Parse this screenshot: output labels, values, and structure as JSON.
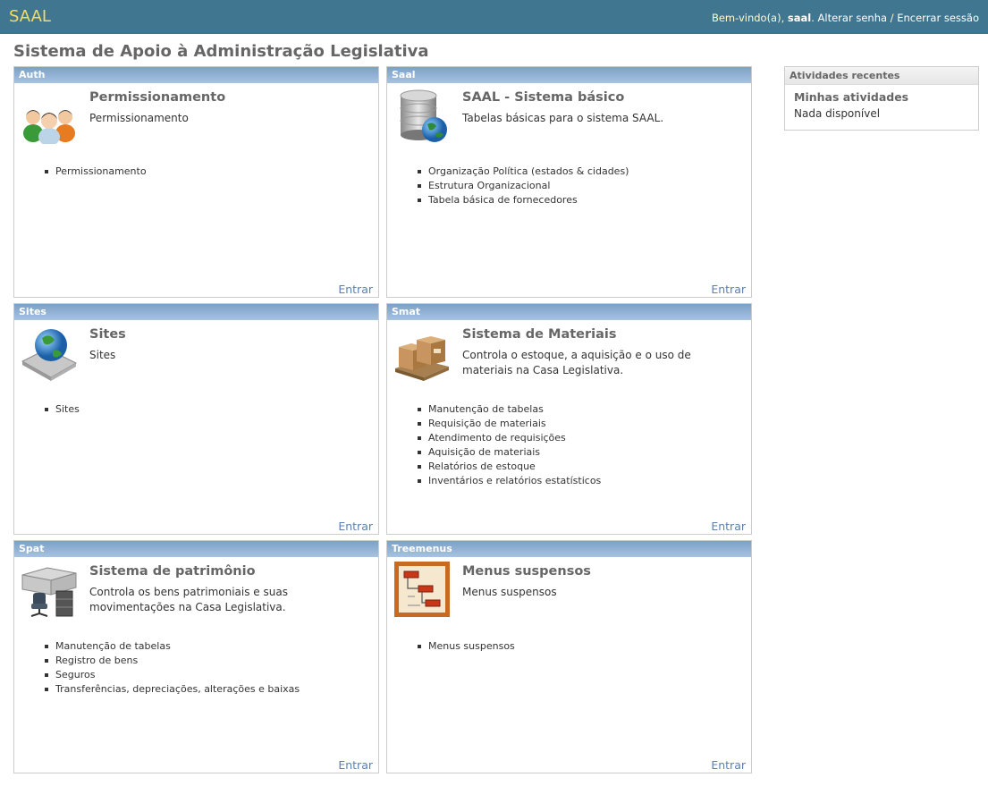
{
  "header": {
    "brand": "SAAL",
    "welcome": "Bem-vindo(a), ",
    "username": "saal",
    "after_user": ". ",
    "change_password": "Alterar senha",
    "separator": " / ",
    "logout": "Encerrar sessão"
  },
  "page_title": "Sistema de Apoio à Administração Legislativa",
  "modules": [
    {
      "caption": "Auth",
      "icon": "users-icon",
      "name": "Permissionamento",
      "description": "Permissionamento",
      "links": [
        "Permissionamento"
      ],
      "enter": "Entrar"
    },
    {
      "caption": "Saal",
      "icon": "database-globe-icon",
      "name": "SAAL - Sistema básico",
      "description": "Tabelas básicas para o sistema SAAL.",
      "links": [
        "Organização Política (estados & cidades)",
        "Estrutura Organizacional",
        "Tabela básica de fornecedores"
      ],
      "enter": "Entrar"
    },
    {
      "caption": "Sites",
      "icon": "globe-icon",
      "name": "Sites",
      "description": "Sites",
      "links": [
        "Sites"
      ],
      "enter": "Entrar"
    },
    {
      "caption": "Smat",
      "icon": "boxes-pallet-icon",
      "name": "Sistema de Materiais",
      "description": "Controla o estoque, a aquisição e o uso de materiais na Casa Legislativa.",
      "links": [
        "Manutenção de tabelas",
        "Requisição de materiais",
        "Atendimento de requisições",
        "Aquisição de materiais",
        "Relatórios de estoque",
        "Inventários e relatórios estatísticos"
      ],
      "enter": "Entrar"
    },
    {
      "caption": "Spat",
      "icon": "office-furniture-icon",
      "name": "Sistema de patrimônio",
      "description": "Controla os bens patrimoniais e suas movimentações na Casa Legislativa.",
      "links": [
        "Manutenção de tabelas",
        "Registro de bens",
        "Seguros",
        "Transferências, depreciações, alterações e baixas"
      ],
      "enter": "Entrar"
    },
    {
      "caption": "Treemenus",
      "icon": "tree-menu-icon",
      "name": "Menus suspensos",
      "description": "Menus suspensos",
      "links": [
        "Menus suspensos"
      ],
      "enter": "Entrar"
    }
  ],
  "recent_actions": {
    "caption": "Atividades recentes",
    "subtitle": "Minhas atividades",
    "empty": "Nada disponível"
  }
}
